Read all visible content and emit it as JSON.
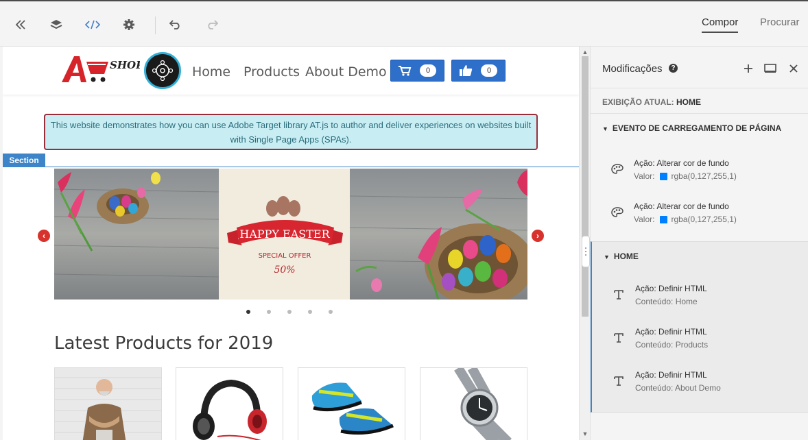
{
  "toolbar": {
    "tabs": [
      {
        "label": "Compor",
        "active": true
      },
      {
        "label": "Procurar",
        "active": false
      }
    ],
    "icons": [
      "double-chevron-left-icon",
      "layers-icon",
      "code-icon",
      "gear-icon",
      "undo-icon",
      "redo-icon"
    ]
  },
  "site": {
    "logo_text": "SHOP",
    "nav": [
      "Home",
      "Products",
      "About Demo"
    ],
    "cart_count": "0",
    "like_count": "0",
    "notice": "This website demonstrates how you can use Adobe Target library AT.js to author and deliver experiences on websites built with Single Page Apps (SPAs).",
    "section_label": "Section",
    "banner": {
      "line1": "HAPPY EASTER",
      "line2": "SPECIAL OFFER",
      "line3": "50%"
    },
    "latest_title": "Latest Products for 2019",
    "carousel_dots": 5,
    "active_dot": 0
  },
  "panel": {
    "title": "Modificações",
    "current_view_label": "EXIBIÇÃO ATUAL:",
    "current_view_value": "HOME",
    "groups": [
      {
        "title": "EVENTO DE CARREGAMENTO DE PÁGINA",
        "actions": [
          {
            "action": "Ação: Alterar cor de fundo",
            "detail_label": "Valor:",
            "detail_value": "rgba(0,127,255,1)"
          },
          {
            "action": "Ação: Alterar cor de fundo",
            "detail_label": "Valor:",
            "detail_value": "rgba(0,127,255,1)"
          }
        ]
      },
      {
        "title": "HOME",
        "actions": [
          {
            "action": "Ação: Definir HTML",
            "detail": "Conteúdo: Home"
          },
          {
            "action": "Ação: Definir HTML",
            "detail": "Conteúdo: Products"
          },
          {
            "action": "Ação: Definir HTML",
            "detail": "Conteúdo: About Demo"
          }
        ]
      }
    ]
  },
  "colors": {
    "accent": "#2d6fc9",
    "swatch": "rgba(0,127,255,1)",
    "notice_bg": "#c8eef4",
    "notice_border": "#9b2d3a"
  }
}
